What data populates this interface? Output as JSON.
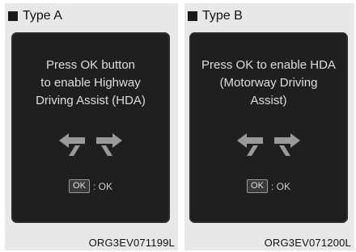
{
  "panels": [
    {
      "type_label": "Type A",
      "message": "Press OK button\nto enable Highway\nDriving Assist (HDA)",
      "ok_key": "OK",
      "ok_text": ": OK",
      "code": "ORG3EV071199L"
    },
    {
      "type_label": "Type B",
      "message": "Press OK to enable HDA\n(Motorway Driving\nAssist)",
      "ok_key": "OK",
      "ok_text": ": OK",
      "code": "ORG3EV071200L"
    }
  ],
  "icons": {
    "bullet": "black-square",
    "lane_change": "lane-change-arrows-icon"
  },
  "colors": {
    "screen_bg": "#1f1f1f",
    "text_light": "#dedede",
    "panel_bg": "#e8e8e8"
  }
}
